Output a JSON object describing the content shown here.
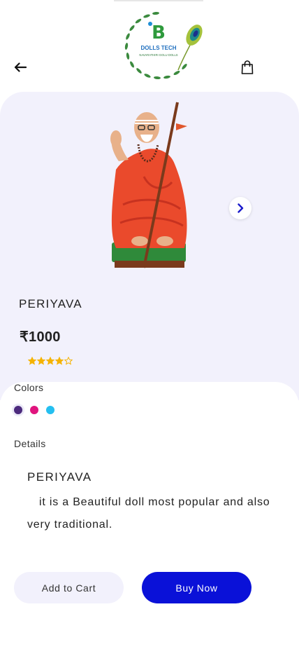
{
  "header": {
    "logo": {
      "brand_letter": "B",
      "line1": "DOLLS TECH",
      "line2": "NAVARATHIRI GOLU DOLLS"
    },
    "back_icon": "arrow-left-icon",
    "bag_icon": "shopping-bag-icon"
  },
  "product": {
    "name": "PERIYAVA",
    "price": "₹1000",
    "rating": 4,
    "rating_max": 5,
    "star_color": "#f5b301"
  },
  "colors": {
    "label": "Colors",
    "options": [
      {
        "hex": "#4c2a7d",
        "selected": true
      },
      {
        "hex": "#e0147e",
        "selected": false
      },
      {
        "hex": "#25bff0",
        "selected": false
      }
    ]
  },
  "details": {
    "label": "Details",
    "title": "PERIYAVA",
    "body": "it is a Beautiful doll most popular and also very traditional."
  },
  "actions": {
    "add_to_cart": "Add to Cart",
    "buy_now": "Buy Now"
  },
  "theme": {
    "panel_bg": "#f2f1fc",
    "primary": "#0a11d8"
  }
}
